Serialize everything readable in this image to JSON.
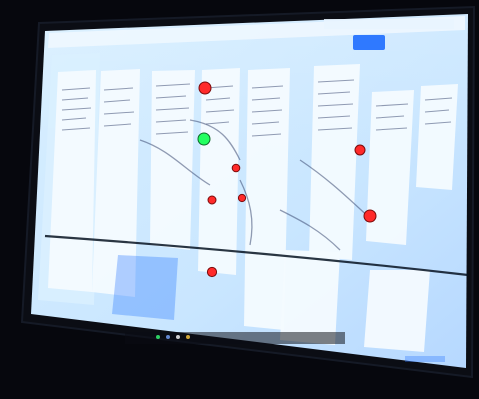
{
  "photo": {
    "subject": "projected-screen",
    "colors": {
      "room": "#06070d",
      "bezel": "#11131a",
      "screen": "#cfe8ff",
      "panel_bg": "#a9cfff",
      "card": "#f4fbff",
      "text_line": "#3c4b72",
      "accent_blue": "#2f79ff",
      "accent_red": "#ff2a2a",
      "accent_green": "#23ff60"
    }
  }
}
